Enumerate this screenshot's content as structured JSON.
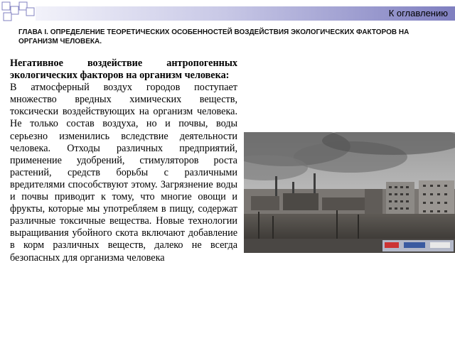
{
  "header": {
    "toc_link": "К оглавлению",
    "chapter_title": "ГЛАВА I. ОПРЕДЕЛЕНИЕ ТЕОРЕТИЧЕСКИХ ОСОБЕННОСТЕЙ ВОЗДЕЙСТВИЯ ЭКОЛОГИЧЕСКИХ ФАКТОРОВ НА ОРГАНИЗМ ЧЕЛОВЕКА."
  },
  "content": {
    "heading": "Негативное воздействие антропогенных экологических факторов на организм человека:",
    "body": "В атмосферный воздух городов поступает множество вредных химических веществ, токсически воздействующих на организм человека. Не только состав воздуха, но и почвы, воды серьезно изменились вследствие деятельности человека. Отходы различных предприятий, применение удобрений, стимуляторов роста растений, средств борьбы с различными вредителями способствуют этому. Загрязнение воды и почвы приводит к тому, что многие овощи и фрукты, которые мы употребляем в пищу, содержат различные токсичные вещества. Новые технологии выращивания убойного скота включают добавление в корм различных веществ, далеко не всегда безопасных для организма человека"
  },
  "image": {
    "subject": "industrial-city-smog-photo"
  },
  "colors": {
    "bar_start": "#f2f2fa",
    "bar_end": "#7f7fc0",
    "square_border": "#8080c0"
  }
}
